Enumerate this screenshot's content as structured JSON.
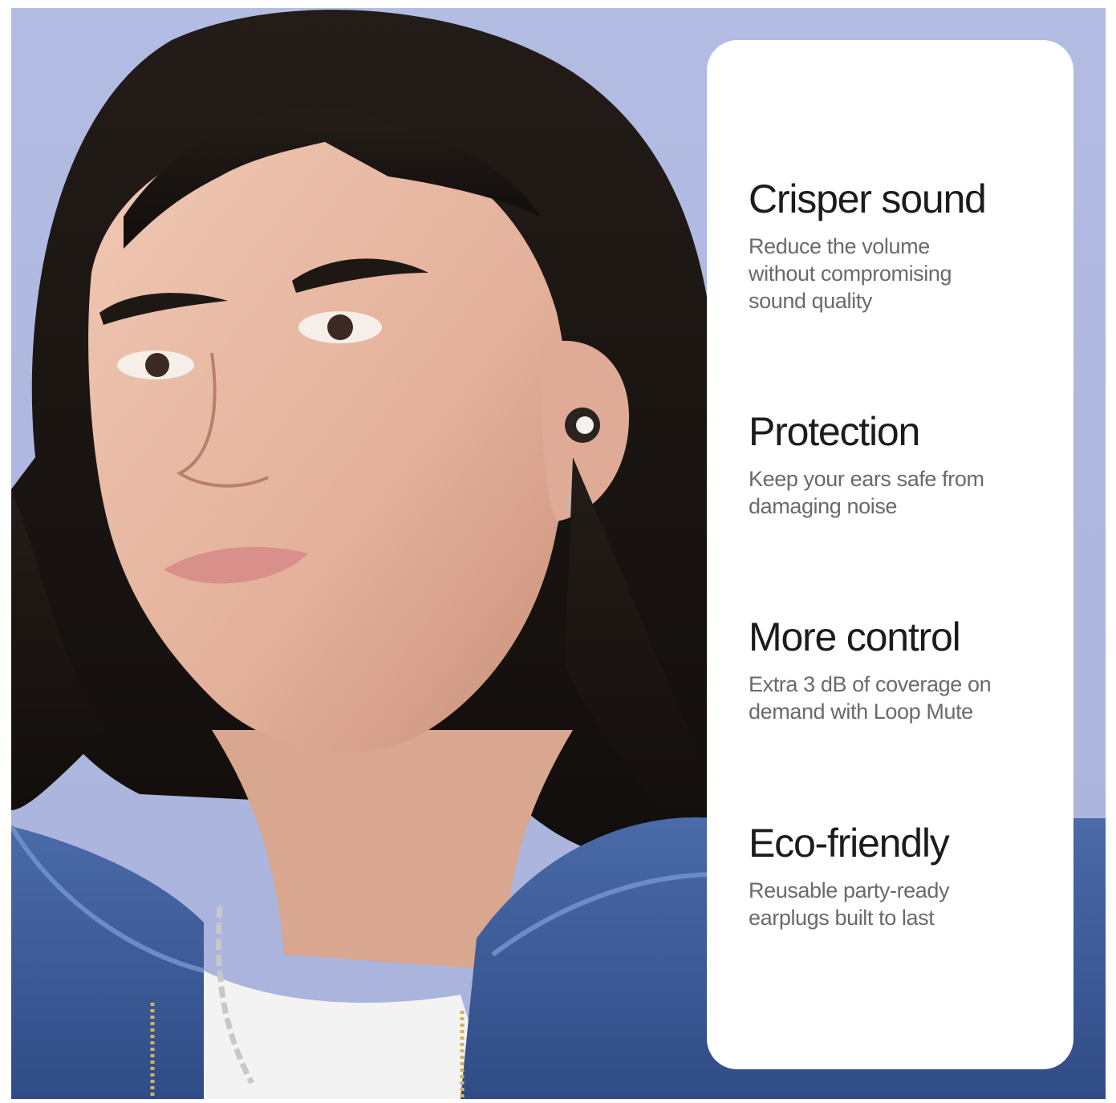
{
  "features": [
    {
      "title": "Crisper sound",
      "description": "Reduce the volume\nwithout compromising\nsound quality"
    },
    {
      "title": "Protection",
      "description": "Keep your ears safe from\ndamaging noise"
    },
    {
      "title": "More control",
      "description": "Extra 3 dB of coverage on\ndemand with Loop Mute"
    },
    {
      "title": "Eco-friendly",
      "description": "Reusable party-ready\nearplugs built to last"
    }
  ],
  "colors": {
    "background": "#aeb8e0",
    "panel": "#ffffff",
    "title_text": "#1c1c1e",
    "body_text": "#6a6a6e",
    "jacket": "#3f5f9f",
    "hair": "#1a1512",
    "skin": "#e6b8a2"
  },
  "icons": [
    "earplug-icon"
  ]
}
